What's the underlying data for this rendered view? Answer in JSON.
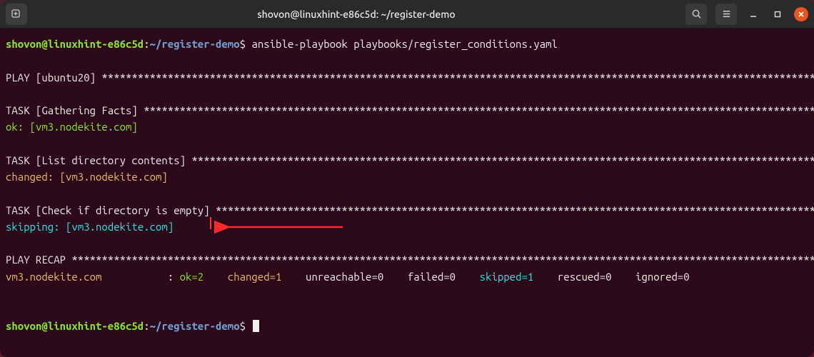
{
  "titlebar": {
    "title": "shovon@linuxhint-e86c5d: ~/register-demo"
  },
  "prompt": {
    "user_host": "shovon@linuxhint-e86c5d",
    "colon": ":",
    "path": "~/register-demo",
    "dollar": "$"
  },
  "command": "ansible-playbook playbooks/register_conditions.yaml",
  "play": {
    "label": "PLAY [ubuntu20] ",
    "stars": "*****************************************************************************************************************************"
  },
  "task1": {
    "label": "TASK [Gathering Facts] ",
    "stars": "**********************************************************************************************************************",
    "status_prefix": "ok: ",
    "host": "[vm3.nodekite.com]"
  },
  "task2": {
    "label": "TASK [List directory contents] ",
    "stars": "**************************************************************************************************************",
    "status_prefix": "changed: ",
    "host": "[vm3.nodekite.com]"
  },
  "task3": {
    "label": "TASK [Check if directory is empty] ",
    "stars": "**********************************************************************************************************",
    "status_prefix": "skipping: ",
    "host": "[vm3.nodekite.com]"
  },
  "recap": {
    "label": "PLAY RECAP ",
    "stars": "*******************************************************************************************************************************",
    "host": "vm3.nodekite.com",
    "pad": "           : ",
    "ok": "ok=2",
    "gap1": "    ",
    "changed": "changed=1",
    "gap2": "    ",
    "unreachable": "unreachable=0",
    "gap3": "    ",
    "failed": "failed=0",
    "gap4": "    ",
    "skipped": "skipped=1",
    "gap5": "    ",
    "rescued": "rescued=0",
    "gap6": "    ",
    "ignored": "ignored=0"
  }
}
